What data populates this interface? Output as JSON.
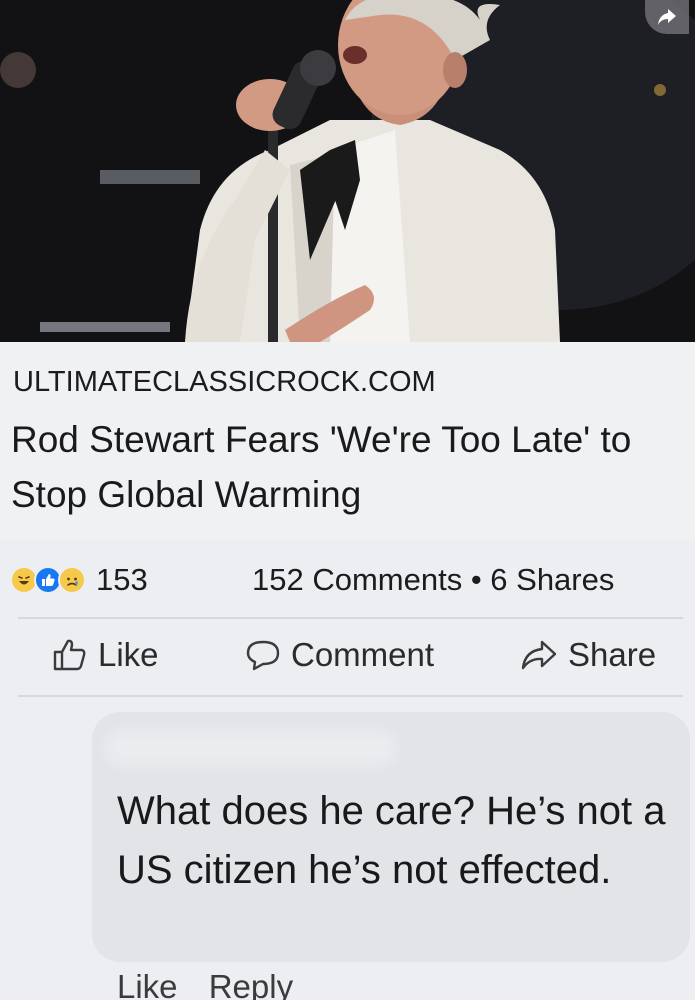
{
  "post": {
    "link_source": "ULTIMATECLASSICROCK.COM",
    "headline": "Rod Stewart Fears 'We're Too Late' to Stop Global Warming",
    "image_icon": "singer-photo"
  },
  "stats": {
    "reaction_icons": [
      "haha-icon",
      "like-icon",
      "sad-icon"
    ],
    "reaction_count": "153",
    "comments_shares": "152 Comments • 6 Shares"
  },
  "actions": {
    "like_label": "Like",
    "comment_label": "Comment",
    "share_label": "Share"
  },
  "comment": {
    "text": "What does he care? He’s not a US citizen he’s not effected.",
    "like_label": "Like",
    "reply_label": "Reply"
  },
  "colors": {
    "background": "#eceef1",
    "comment_bubble": "#e2e4e8",
    "like_blue": "#1877f2",
    "reaction_yellow": "#f7c94b"
  }
}
